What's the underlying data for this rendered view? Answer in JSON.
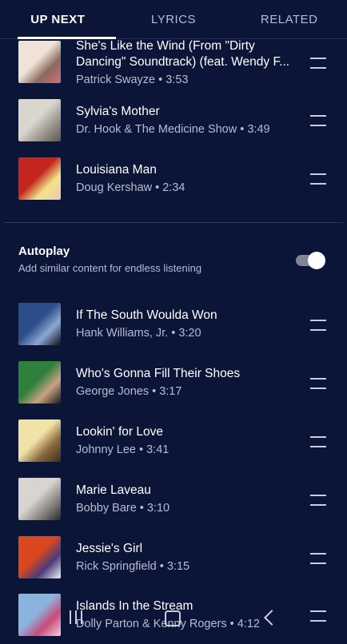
{
  "tabs": {
    "up_next": "UP NEXT",
    "lyrics": "LYRICS",
    "related": "RELATED"
  },
  "queue": [
    {
      "title": "She's Like the Wind (From \"Dirty Dancing\" Soundtrack) (feat. Wendy F...",
      "subtitle": "Patrick Swayze • 3:53",
      "art": [
        "#efe2d6",
        "#d66c7b",
        "#8a6a5e"
      ]
    },
    {
      "title": "Sylvia's Mother",
      "subtitle": "Dr. Hook & The Medicine Show • 3:49",
      "art": [
        "#d9d6d0",
        "#5a5752",
        "#9d9890"
      ]
    },
    {
      "title": "Louisiana Man",
      "subtitle": "Doug Kershaw • 2:34",
      "art": [
        "#c4251f",
        "#e9c7b0",
        "#f2e38a"
      ]
    }
  ],
  "autoplay": {
    "title": "Autoplay",
    "subtitle": "Add similar content for endless listening",
    "enabled": true
  },
  "autoplay_queue": [
    {
      "title": "If The South Woulda Won",
      "subtitle": "Hank Williams, Jr. • 3:20",
      "art": [
        "#2c4d8a",
        "#101014",
        "#8aa7d4"
      ]
    },
    {
      "title": "Who's Gonna Fill Their Shoes",
      "subtitle": "George Jones • 3:17",
      "art": [
        "#2f7f3d",
        "#1a1a1a",
        "#c9a384"
      ]
    },
    {
      "title": "Lookin' for Love",
      "subtitle": "Johnny Lee • 3:41",
      "art": [
        "#f1e2a8",
        "#3b2e1f",
        "#8b6a3e"
      ]
    },
    {
      "title": "Marie Laveau",
      "subtitle": "Bobby Bare • 3:10",
      "art": [
        "#d8d4cf",
        "#2a2a2a",
        "#8d8a86"
      ]
    },
    {
      "title": "Jessie's Girl",
      "subtitle": "Rick Springfield • 3:15",
      "art": [
        "#d9481f",
        "#f2f2f2",
        "#4a3a7a"
      ]
    },
    {
      "title": "Islands In the Stream",
      "subtitle": "Dolly Parton & Kenny Rogers • 4:12",
      "art": [
        "#8ab4de",
        "#f2d0d8",
        "#c94a7a"
      ]
    }
  ],
  "icons": {
    "drag_handle": "drag-handle-icon",
    "nav_recent": "recent-apps-icon",
    "nav_home": "home-icon",
    "nav_back": "back-icon"
  },
  "colors": {
    "background": "#0b1538",
    "secondary_text": "#b6bcd1",
    "divider": "#2c3560"
  }
}
